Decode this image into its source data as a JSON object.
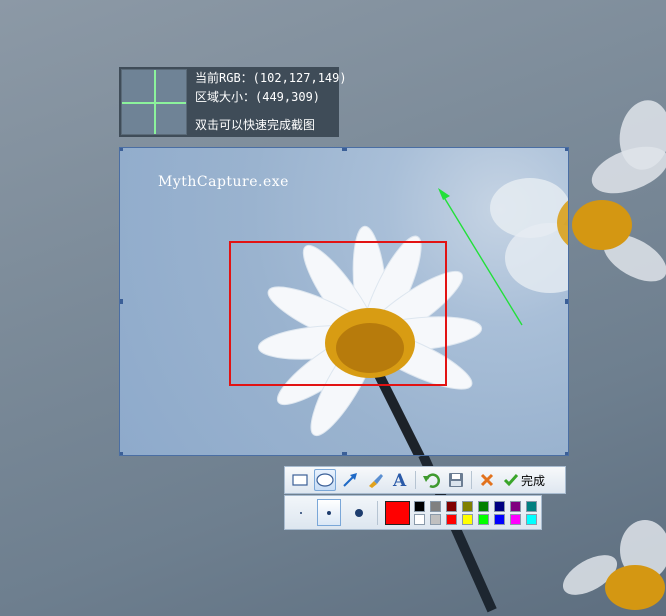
{
  "info": {
    "rgb_line": "当前RGB：(102,127,149)",
    "size_line": "区域大小：(449,309)",
    "hint_line": "双击可以快速完成截图"
  },
  "selection": {
    "watermark": "MythCapture.exe"
  },
  "toolbar": {
    "tools": [
      {
        "name": "rectangle-tool",
        "icon": "rectangle-icon",
        "active": false
      },
      {
        "name": "ellipse-tool",
        "icon": "ellipse-icon",
        "active": true
      },
      {
        "name": "arrow-tool",
        "icon": "arrow-icon",
        "active": false
      },
      {
        "name": "brush-tool",
        "icon": "brush-icon",
        "active": false
      },
      {
        "name": "text-tool",
        "icon": "text-icon",
        "active": false
      },
      {
        "name": "undo-tool",
        "icon": "undo-icon",
        "active": false
      },
      {
        "name": "save-tool",
        "icon": "save-icon",
        "active": false
      },
      {
        "name": "cancel-tool",
        "icon": "close-icon",
        "active": false
      }
    ],
    "done_label": "完成"
  },
  "palette": {
    "current_color": "#ff0000",
    "pen_sizes": [
      "small",
      "medium",
      "large"
    ],
    "selected_size": "medium",
    "colors_top": [
      "#000000",
      "#808080",
      "#800000",
      "#808000",
      "#008000",
      "#000080",
      "#800080",
      "#008080"
    ],
    "colors_bottom": [
      "#ffffff",
      "#c0c0c0",
      "#ff0000",
      "#ffff00",
      "#00ff00",
      "#0000ff",
      "#ff00ff",
      "#00ffff"
    ]
  },
  "colors": {
    "annotation_rect": "#e21313",
    "annotation_arrow": "#22e03a",
    "crosshair": "#8cf29c"
  }
}
